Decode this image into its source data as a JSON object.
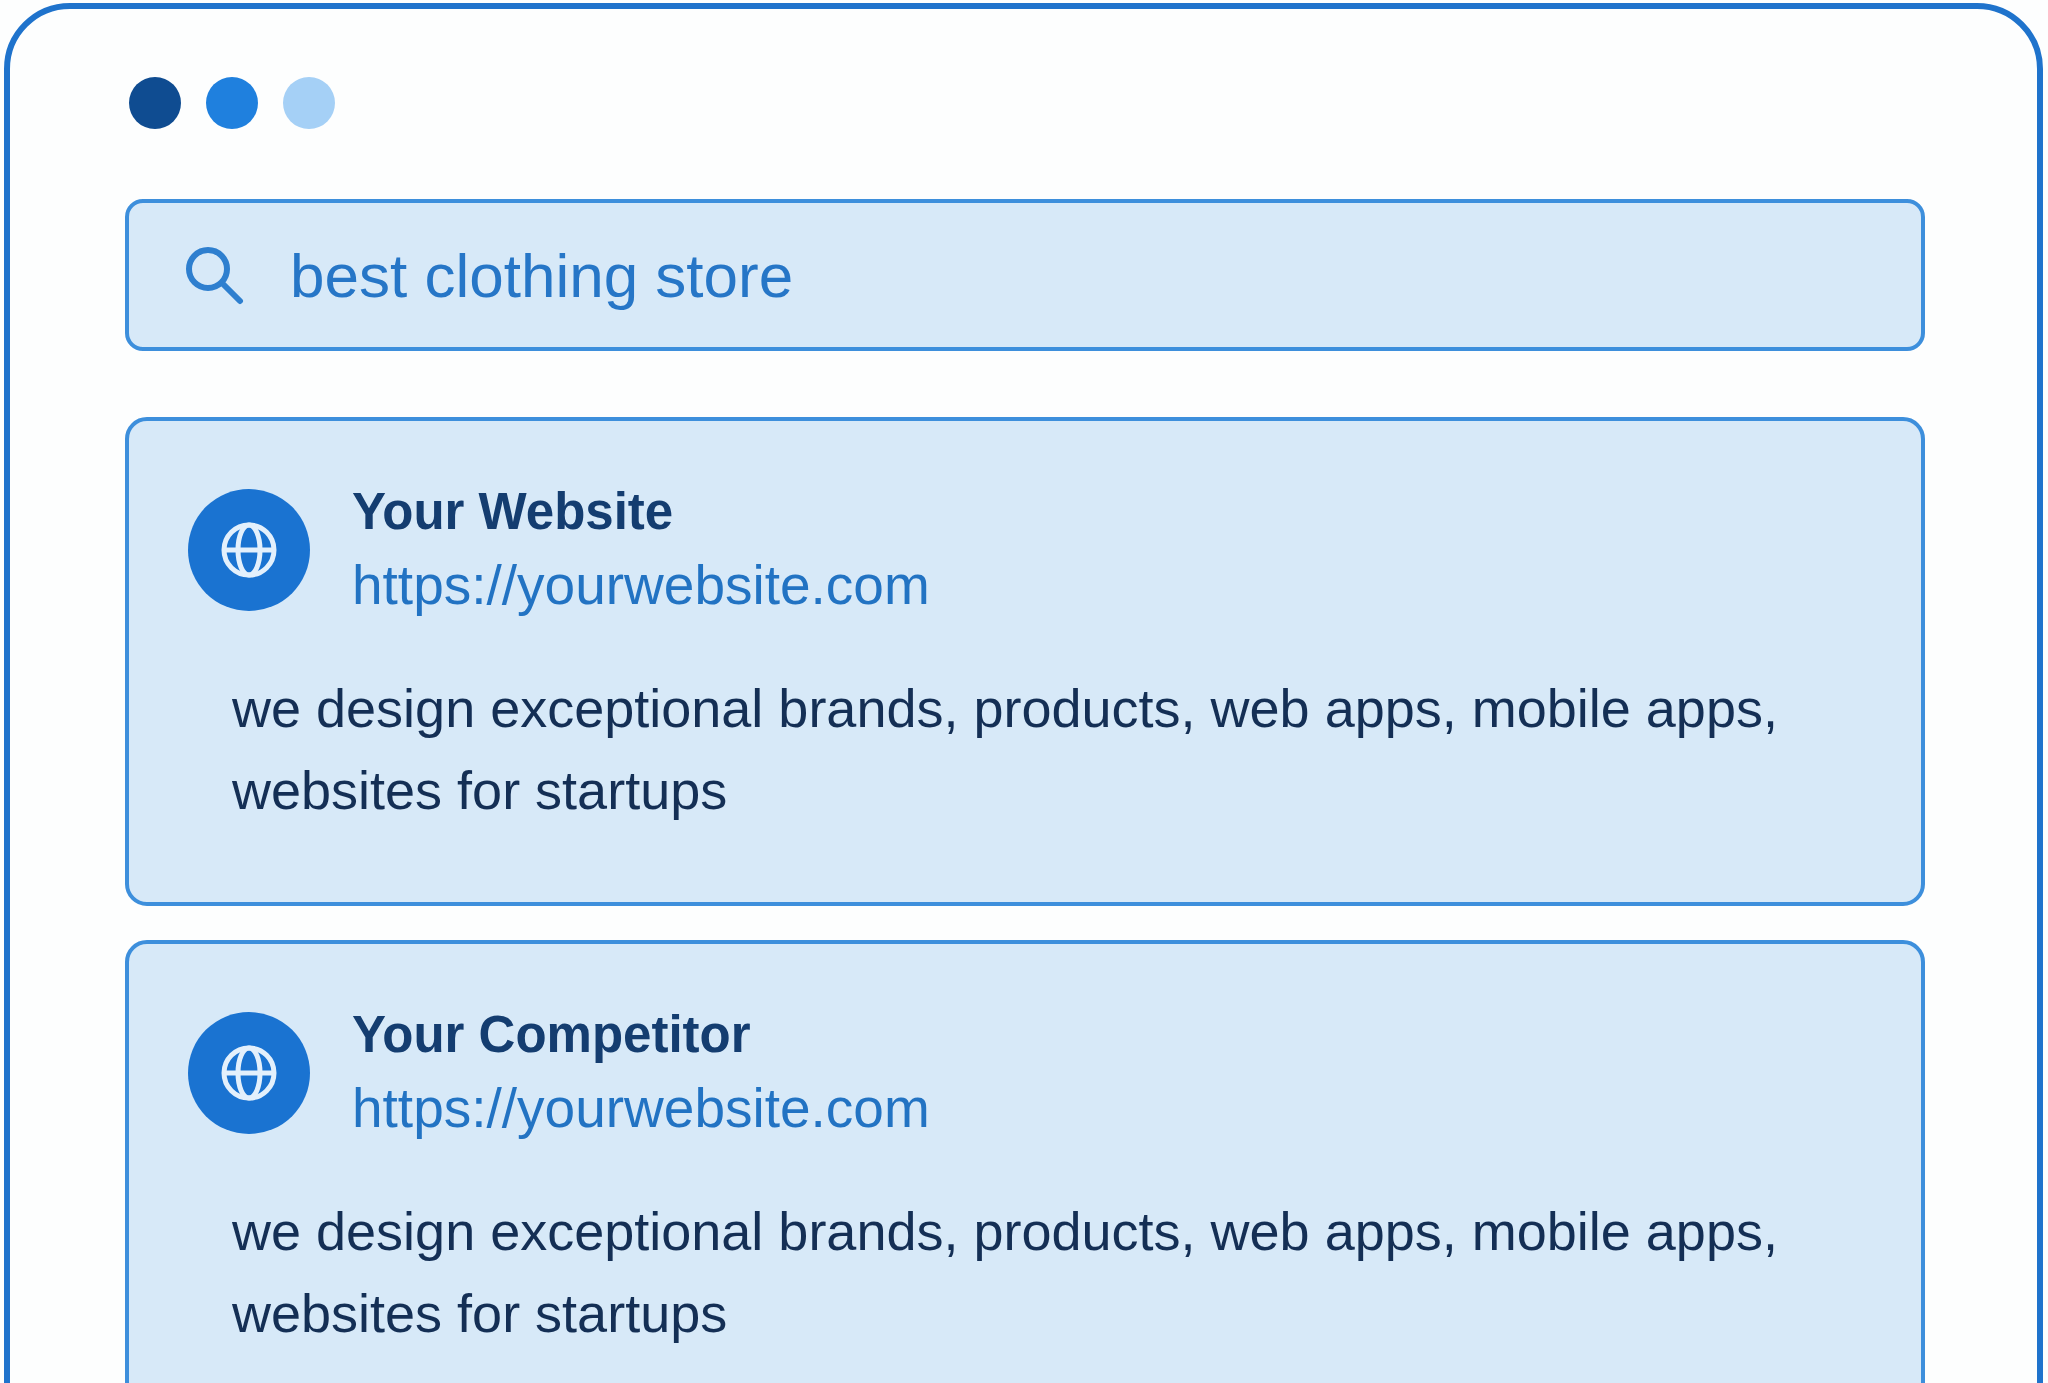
{
  "window": {
    "controls": [
      {
        "color": "#0f4c91"
      },
      {
        "color": "#1f80de"
      },
      {
        "color": "#a5d0f6"
      }
    ]
  },
  "search": {
    "value": "best clothing store"
  },
  "results": [
    {
      "title": "Your Website",
      "url": "https://yourwebsite.com",
      "description": "we design exceptional brands, products, web apps, mobile apps, websites for startups"
    },
    {
      "title": "Your Competitor",
      "url": "https://yourwebsite.com",
      "description": "we design exceptional brands, products, web apps, mobile apps, websites for startups"
    }
  ]
}
